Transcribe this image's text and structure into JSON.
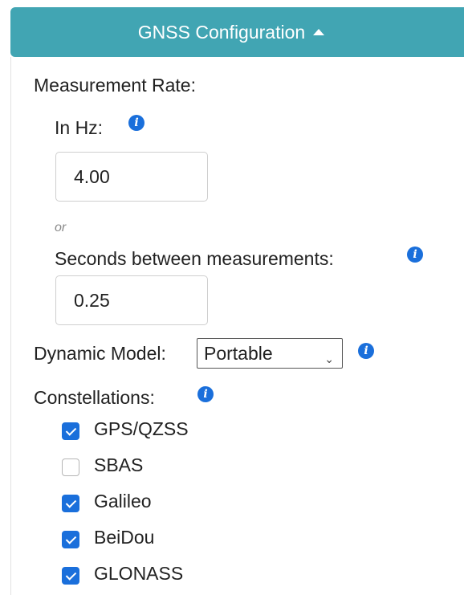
{
  "header": {
    "title": "GNSS Configuration"
  },
  "measurement": {
    "label": "Measurement Rate:",
    "hz_label": "In Hz:",
    "hz_value": "4.00",
    "or_text": "or",
    "seconds_label": "Seconds between measurements:",
    "seconds_value": "0.25"
  },
  "dynamic_model": {
    "label": "Dynamic Model:",
    "selected": "Portable"
  },
  "constellations": {
    "label": "Constellations:",
    "items": [
      {
        "label": "GPS/QZSS",
        "checked": true
      },
      {
        "label": "SBAS",
        "checked": false
      },
      {
        "label": "Galileo",
        "checked": true
      },
      {
        "label": "BeiDou",
        "checked": true
      },
      {
        "label": "GLONASS",
        "checked": true
      }
    ]
  },
  "colors": {
    "header_bg": "#41a5b3",
    "accent": "#1a6fdb"
  },
  "icons": {
    "info": "info-icon",
    "caret": "caret-up-icon",
    "select_chevron": "chevron-down-icon"
  }
}
